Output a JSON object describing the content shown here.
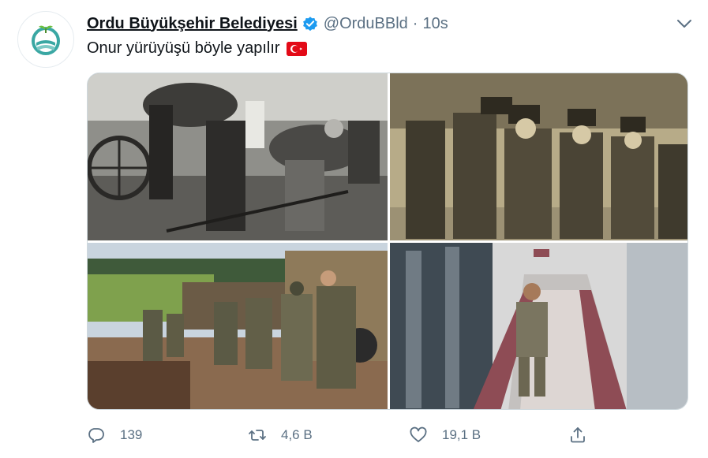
{
  "tweet": {
    "display_name": "Ordu Büyükşehir Belediyesi",
    "handle": "@OrduBBld",
    "separator": "·",
    "time": "10s",
    "verified": true,
    "text": "Onur yürüyüşü böyle yapılır",
    "emoji": "turkish-flag",
    "media": [
      {
        "description_icon": "historic-women-oxcart-photo"
      },
      {
        "description_icon": "historic-child-soldiers-photo"
      },
      {
        "description_icon": "soldiers-marching-convoy-photo"
      },
      {
        "description_icon": "soldier-walking-corridor-photo"
      }
    ],
    "actions": {
      "reply_count": "139",
      "retweet_count": "4,6 B",
      "like_count": "19,1 B"
    }
  },
  "colors": {
    "verified": "#1d9bf0",
    "secondary_text": "#5b7083",
    "flag_red": "#e30a17",
    "avatar_teal": "#3aa7a3",
    "avatar_green": "#6cbf3f"
  }
}
